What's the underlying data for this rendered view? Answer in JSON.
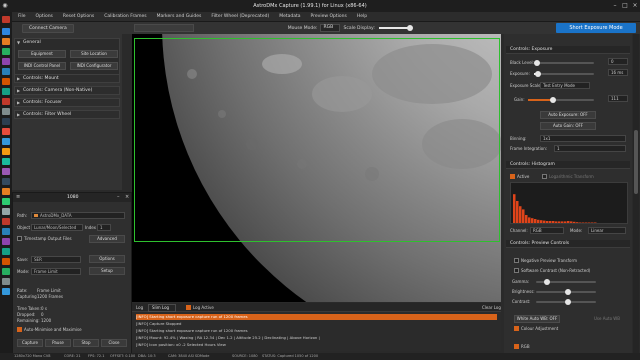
{
  "titlebar": {
    "title": "AstroDMx Capture (1.99.1) for Linux (x86-64)"
  },
  "menu": [
    "File",
    "Options",
    "Reset Options",
    "Calibration Frames",
    "Markers and Guides",
    "Filter Wheel (Deprecated)",
    "Metadata",
    "Preview Options",
    "Help"
  ],
  "toolbar": {
    "connect_label": "Connect Camera",
    "mouse_mode_label": "Mouse Mode:",
    "mouse_mode_value": "RGB",
    "scale_display_label": "Scale Display:",
    "zoom_value": "30 %",
    "right_value": "100",
    "short_exposure_label": "Short Exposure Mode"
  },
  "left_panel": {
    "general": "General",
    "buttons": [
      "Equipment",
      "Site Location",
      "INDI Control Panel",
      "INDI Configurator"
    ],
    "sections": [
      "Controls: Mount",
      "Controls: Camera (Non-Native)",
      "Controls: Focuser",
      "Controls: Filter Wheel"
    ]
  },
  "float_window": {
    "title": "1080",
    "path_label": "Path:",
    "path_value": "AstroDMx_DATA",
    "object_label": "Object",
    "object_value": "Lunar/Moon/Selected",
    "index_label": "Index",
    "index_value": "1",
    "timestamp_label": "Timestamp Output Files",
    "advanced_label": "Advanced",
    "save_label": "Save:",
    "save_value": "SER",
    "options_label": "Options",
    "mode_label": "Mode:",
    "mode_value": "Frame Limit",
    "setup_label": "Setup",
    "rate_label": "Rate:",
    "rate_value": "Frame Limit",
    "capturing_label": "Capturing",
    "capturing_value": "1200 Frames",
    "time_taken_label": "Time Taken:",
    "time_taken_value": "0 s",
    "dropped_label": "Dropped:",
    "dropped_value": "0",
    "remaining_label": "Remaining:",
    "remaining_value": "1200",
    "auto_label": "Auto-Minimise and Maximise",
    "buttons": [
      "Capture",
      "Pause",
      "Stop",
      "Close"
    ]
  },
  "log": {
    "tab_label": "Log",
    "filter_value": "Slim Log",
    "log_active_label": "Log Active",
    "clear_label": "Clear Log",
    "lines": [
      "[INFO] Starting short exposure capture run of 1200 frames",
      "[INFO] Capture Stopped",
      "[INFO] Starting short exposure capture run of 1200 frames",
      "[INFO] Mount: 92.4% | Waxing | RA 12.34 | Dec 1.2 | Altitude 25.2 | Declinating | Above Horizon |",
      "[INFO] Icon position: x0 -2 Selected Hours View"
    ]
  },
  "status": {
    "items": [
      "1280x720 Mono CV8",
      "CORE: 21",
      "FPS: 72.1",
      "OFFSET: 0.100",
      "DBA: 10:3",
      "CAM: 3840 ASI SDMode",
      "SOURCE: 1080",
      "STATUS: Captured 1050 of 1200"
    ]
  },
  "right_panel": {
    "exposure_header": "Controls: Exposure",
    "black_level_label": "Black Level:",
    "black_level_value": "0",
    "exposure_label": "Exposure:",
    "exposure_value": "16 ms",
    "exposure_scale_label": "Exposure Scale:",
    "exposure_scale_value": "Test Entry Mode",
    "gain_label": "Gain:",
    "gain_value": "111",
    "auto_exposure_label": "Auto Exposure: OFF",
    "auto_gain_label": "Auto Gain: OFF",
    "binning_label": "Binning:",
    "binning_value": "1x1",
    "frame_integration_label": "Frame Integration:",
    "frame_integration_value": "1",
    "histogram_header": "Controls: Histogram",
    "active_label": "Active",
    "logarithmic_label": "Logarithmic Transform",
    "channel_label": "Channel:",
    "channel_value": "RGB",
    "mode_label": "Mode:",
    "mode_value": "Linear",
    "preview_header": "Controls: Preview Controls",
    "negative_label": "Negative Preview Transform",
    "software_contrast_label": "Software Contrast (Non-Retracted)",
    "gamma_label": "Gamma:",
    "brightness_label": "Brightness:",
    "contrast_label": "Contrast:",
    "white_balance_label": "White Auto WB: OFF",
    "adjust_label": "Use Auto WB",
    "color_balance_label": "Colour Adjustment",
    "last_label": "RGB"
  },
  "colors": {
    "accent": "#1a73c8",
    "frame_border": "#2ec02e",
    "log_highlight": "#d8631a",
    "histogram": "#e0441a"
  },
  "histogram": {
    "values": [
      0.72,
      0.55,
      0.42,
      0.34,
      0.2,
      0.14,
      0.12,
      0.1,
      0.08,
      0.07,
      0.06,
      0.05,
      0.05,
      0.05,
      0.04,
      0.04,
      0.04,
      0.04,
      0.05,
      0.04,
      0.03,
      0.02,
      0.01,
      0.01,
      0.005,
      0.004,
      0.003,
      0.002
    ]
  }
}
